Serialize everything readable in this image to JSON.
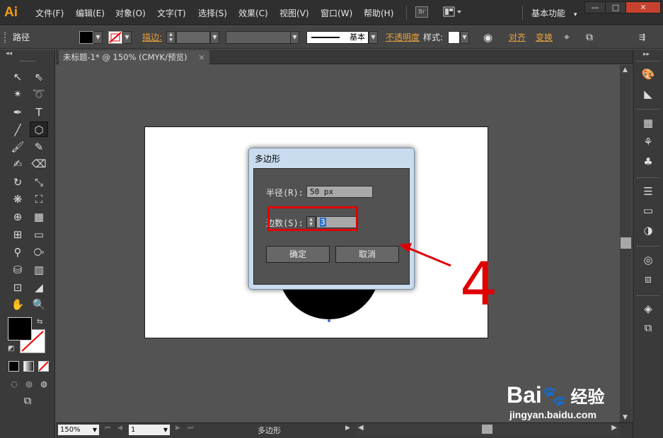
{
  "app": {
    "logo": "Ai",
    "workspace": "基本功能",
    "workspace_arrow": "▾"
  },
  "menu": [
    {
      "label": "文件(F)"
    },
    {
      "label": "编辑(E)"
    },
    {
      "label": "对象(O)"
    },
    {
      "label": "文字(T)"
    },
    {
      "label": "选择(S)"
    },
    {
      "label": "效果(C)"
    },
    {
      "label": "视图(V)"
    },
    {
      "label": "窗口(W)"
    },
    {
      "label": "帮助(H)"
    }
  ],
  "bridge_label": "Br",
  "window_controls": {
    "minimize": "—",
    "maximize": "□",
    "close": "✕"
  },
  "control_bar": {
    "selection_label": "路径",
    "stroke_label": "描边:",
    "brush_label": "基本",
    "opacity_label": "不透明度",
    "style_label": "样式:",
    "align_label": "对齐",
    "transform_label": "变换"
  },
  "document": {
    "tab_title": "未标题-1* @ 150% (CMYK/预览)",
    "close": "×"
  },
  "status_bar": {
    "zoom": "150%",
    "page": "1",
    "tool_status": "多边形"
  },
  "dialog": {
    "title": "多边形",
    "radius_label": "半径(R):",
    "radius_value": "50 px",
    "sides_label": "边数(S):",
    "sides_value": "3",
    "ok_label": "确定",
    "cancel_label": "取消"
  },
  "annotation": {
    "step_number": "4",
    "color": "#e00000"
  },
  "watermark": {
    "brand": "Bai",
    "brand_suffix": "经验",
    "url": "jingyan.baidu.com"
  },
  "colors": {
    "menubar": "#2f2f2f",
    "canvas": "#535353",
    "dialog_frame": "#c9dcef",
    "accent_orange": "#e8a03b"
  }
}
